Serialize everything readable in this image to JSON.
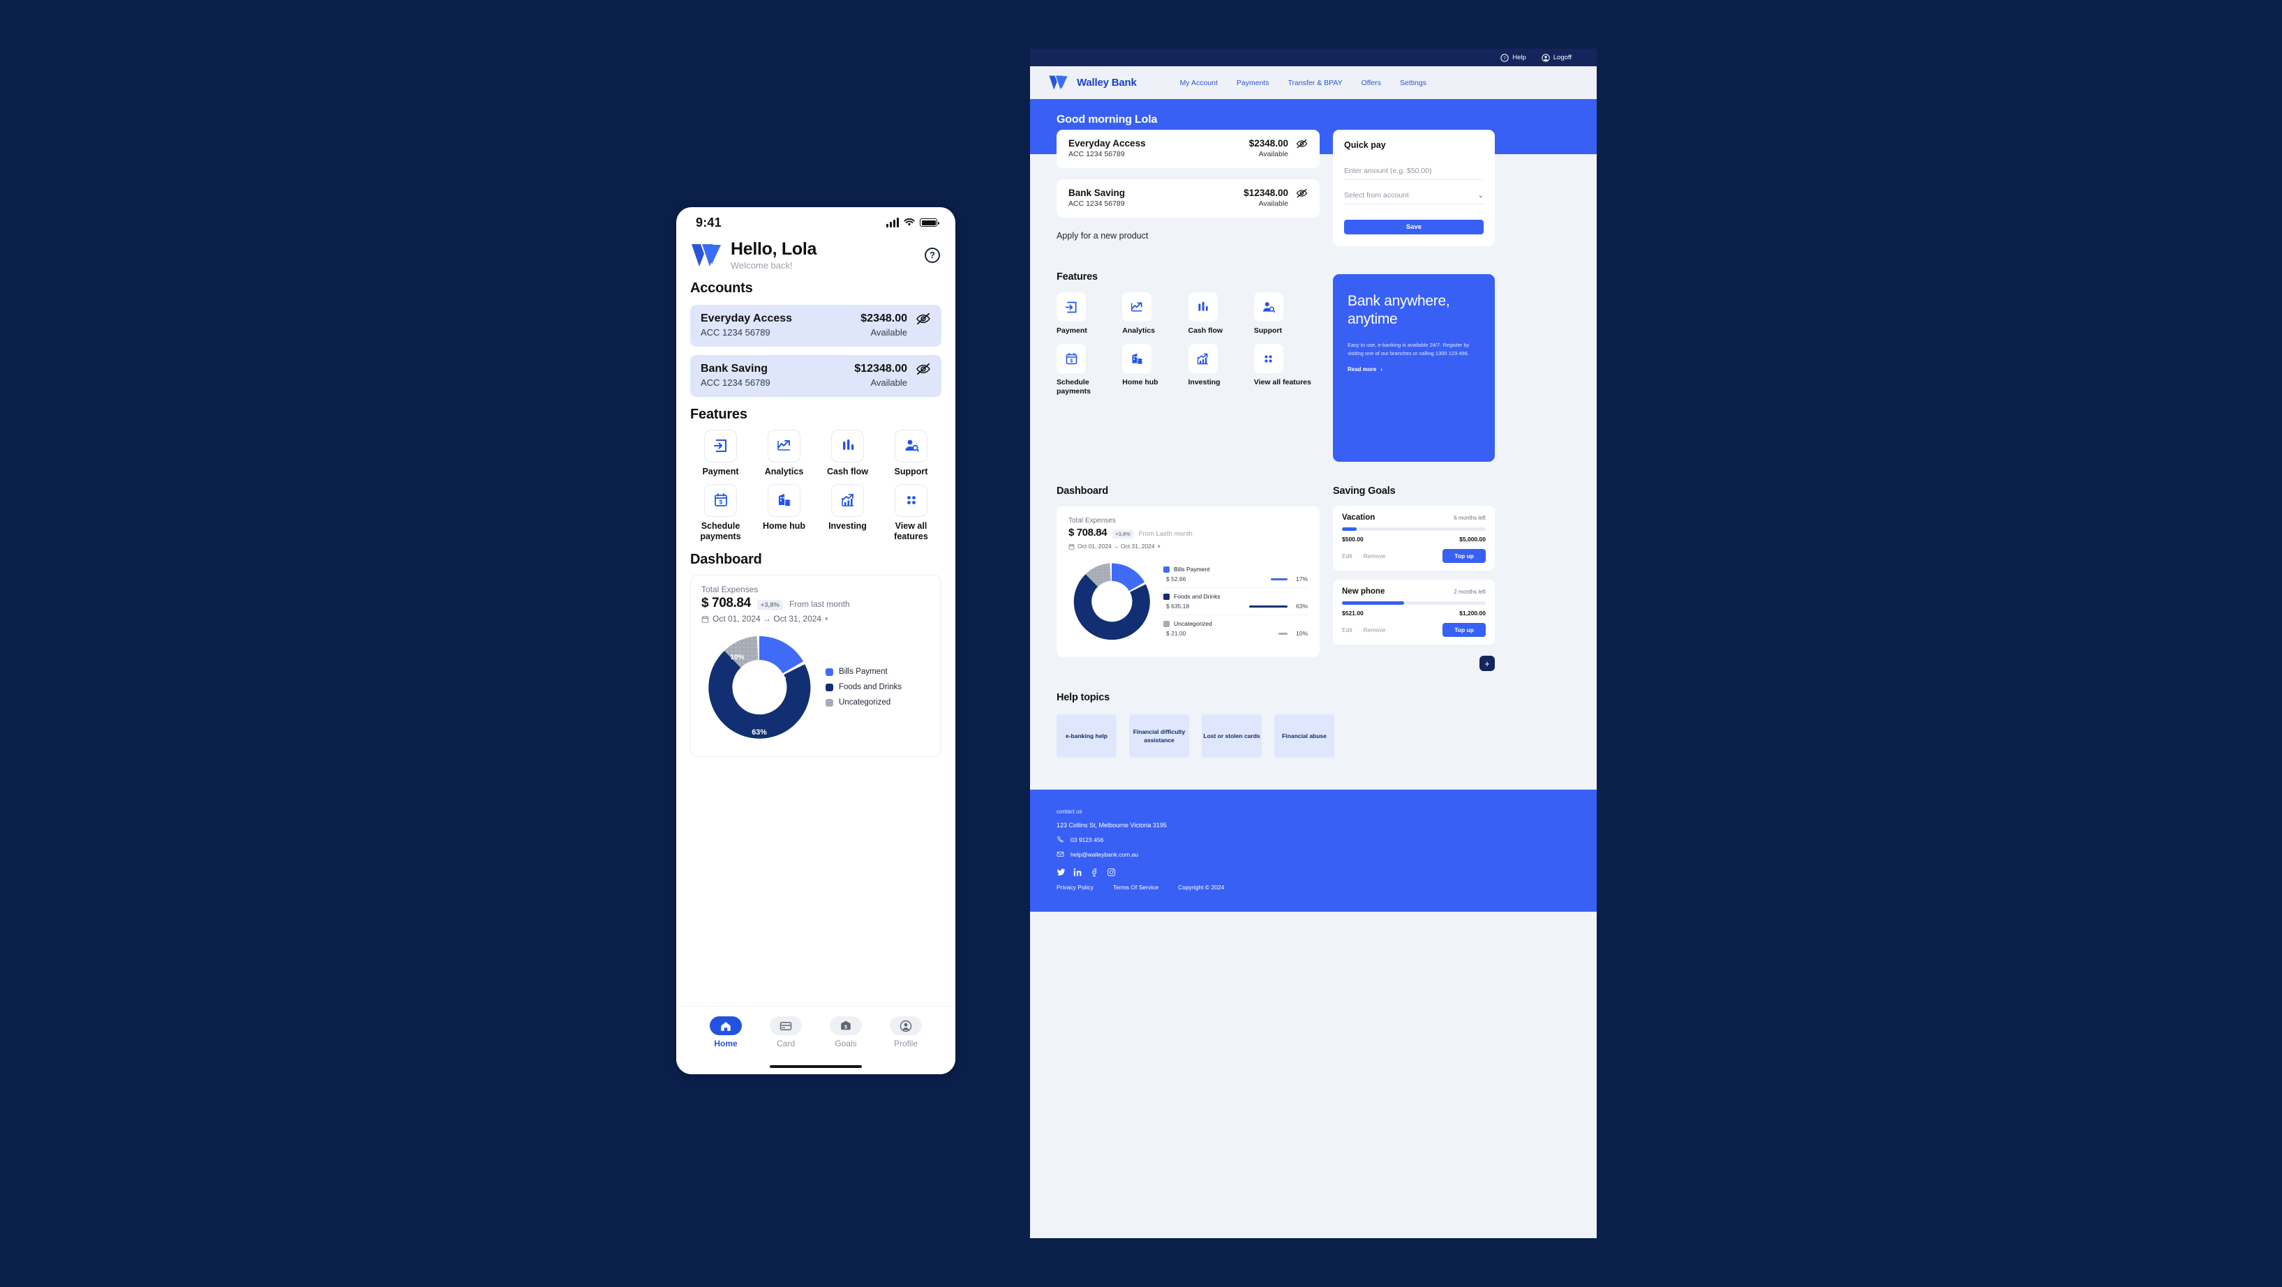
{
  "mobile": {
    "status": {
      "time": "9:41",
      "signal_icon": "cellular-bars-icon",
      "wifi_icon": "wifi-icon",
      "battery_icon": "battery-icon"
    },
    "header": {
      "logo": "walley-bank-logo",
      "greeting": "Hello, Lola",
      "subtitle": "Welcome back!",
      "help_icon": "help-circle-icon"
    },
    "accounts_title": "Accounts",
    "accounts": [
      {
        "name": "Everyday Access",
        "amount": "$2348.00",
        "number": "ACC 1234 56789",
        "status": "Available",
        "eye_icon": "eye-off-icon"
      },
      {
        "name": "Bank Saving",
        "amount": "$12348.00",
        "number": "ACC 1234 56789",
        "status": "Available",
        "eye_icon": "eye-off-icon"
      }
    ],
    "features_title": "Features",
    "features": [
      {
        "label": "Payment",
        "icon": "arrow-into-box-icon"
      },
      {
        "label": "Analytics",
        "icon": "line-chart-arrow-icon"
      },
      {
        "label": "Cash flow",
        "icon": "bar-chart-icon"
      },
      {
        "label": "Support",
        "icon": "person-search-icon"
      },
      {
        "label": "Schedule payments",
        "icon": "calendar-dollar-icon"
      },
      {
        "label": "Home hub",
        "icon": "building-coins-icon"
      },
      {
        "label": "Investing",
        "icon": "growth-chart-icon"
      },
      {
        "label": "View all features",
        "icon": "grid-dots-icon"
      }
    ],
    "dashboard_title": "Dashboard",
    "dashboard": {
      "total_label": "Total Expenses",
      "total_amount": "$ 708.84",
      "change_badge": "+3,8%",
      "change_text": "From last month",
      "date_range": "Oct 01, 2024 → Oct 31, 2024",
      "calendar_icon": "calendar-icon",
      "chevron_icon": "chevron-down-icon"
    },
    "tabs": [
      {
        "label": "Home",
        "icon": "home-icon",
        "active": true
      },
      {
        "label": "Card",
        "icon": "credit-card-icon",
        "active": false
      },
      {
        "label": "Goals",
        "icon": "tag-dollar-icon",
        "active": false
      },
      {
        "label": "Profile",
        "icon": "person-icon",
        "active": false
      }
    ]
  },
  "web": {
    "topbar": [
      {
        "label": "Help",
        "icon": "help-circle-icon"
      },
      {
        "label": "Logoff",
        "icon": "user-circle-icon"
      }
    ],
    "brand": {
      "name": "Walley Bank",
      "logo": "walley-bank-logo"
    },
    "nav": [
      {
        "label": "My Account"
      },
      {
        "label": "Payments"
      },
      {
        "label": "Transfer & BPAY"
      },
      {
        "label": "Offers"
      },
      {
        "label": "Settings"
      }
    ],
    "hero_greeting": "Good morning Lola",
    "accounts": [
      {
        "name": "Everyday Access",
        "amount": "$2348.00",
        "number": "ACC 1234 56789",
        "status": "Available",
        "eye_icon": "eye-off-icon"
      },
      {
        "name": "Bank Saving",
        "amount": "$12348.00",
        "number": "ACC 1234 56789",
        "status": "Available",
        "eye_icon": "eye-off-icon"
      }
    ],
    "apply_link": "Apply for a new product",
    "quick_pay": {
      "title": "Quick pay",
      "amount_placeholder": "Enter amount (e.g. $50.00)",
      "account_placeholder": "Select from account",
      "chevron_icon": "chevron-down-icon",
      "save_label": "Save"
    },
    "features_title": "Features",
    "features": [
      {
        "label": "Payment",
        "icon": "arrow-into-box-icon"
      },
      {
        "label": "Analytics",
        "icon": "line-chart-arrow-icon"
      },
      {
        "label": "Cash flow",
        "icon": "bar-chart-icon"
      },
      {
        "label": "Support",
        "icon": "person-search-icon"
      },
      {
        "label": "Schedule payments",
        "icon": "calendar-dollar-icon"
      },
      {
        "label": "Home hub",
        "icon": "building-coins-icon"
      },
      {
        "label": "Investing",
        "icon": "growth-chart-icon"
      },
      {
        "label": "View all features",
        "icon": "grid-dots-icon"
      }
    ],
    "promo": {
      "title": "Bank anywhere, anytime",
      "body": "Easy to use, e-banking is available 24/7. Register by visiting one of our branches or calling 1300 123 456.",
      "cta": "Read more",
      "cta_icon": "chevron-right-icon"
    },
    "dashboard_title": "Dashboard",
    "dashboard": {
      "total_label": "Total Expenses",
      "total_amount": "$ 708.84",
      "change_badge": "+3,8%",
      "change_text": "From Lasth month",
      "date_range": "Oct 01, 2024 → Oct 31, 2024",
      "calendar_icon": "calendar-icon",
      "chevron_icon": "chevron-down-icon"
    },
    "goals_title": "Saving Goals",
    "goals": [
      {
        "name": "Vacation",
        "time_left": "6 months left",
        "current": "$500.00",
        "target": "$5,000.00",
        "percent": 10,
        "edit": "Edit",
        "remove": "Remove",
        "topup": "Top up"
      },
      {
        "name": "New phone",
        "time_left": "2 months left",
        "current": "$521.00",
        "target": "$1,200.00",
        "percent": 43,
        "edit": "Edit",
        "remove": "Remove",
        "topup": "Top up"
      }
    ],
    "add_goal_icon": "plus-icon",
    "help_title": "Help topics",
    "help_topics": [
      {
        "label": "e-banking help"
      },
      {
        "label": "Financial difficulty assistance"
      },
      {
        "label": "Lost or stolen cards"
      },
      {
        "label": "Financial abuse"
      }
    ],
    "footer": {
      "contact_label": "contact us",
      "address": "123 Collins St, Melbourne Victoria 3195",
      "phone": "03 9123 456",
      "phone_icon": "phone-icon",
      "email": "help@walleybank.com.au",
      "email_icon": "mail-icon",
      "social": [
        "twitter-icon",
        "linkedin-icon",
        "facebook-icon",
        "instagram-icon"
      ],
      "links": [
        "Privacy Policy",
        "Terms Of Service",
        "Copyright © 2024"
      ]
    }
  },
  "chart_data": {
    "type": "pie",
    "title": "Total Expenses",
    "total": 708.84,
    "currency": "$",
    "categories": [
      "Bills Payment",
      "Foods and Drinks",
      "Uncategorized"
    ],
    "values": [
      52.66,
      635.18,
      21.0
    ],
    "percents": [
      17,
      63,
      10
    ],
    "value_labels": [
      "$ 52.66",
      "$ 635.18",
      "$ 21.00"
    ],
    "percent_labels": [
      "17%",
      "63%",
      "10%"
    ],
    "colors": [
      "#3f6bf7",
      "#112f72",
      "#a6acb5"
    ],
    "legend_position": "right",
    "donut_hole": 0.58,
    "date_range": "Oct 01, 2024 → Oct 31, 2024",
    "change": "+3,8%",
    "change_note": "From last month"
  },
  "theme": {
    "brand_blue": "#3860f4",
    "navy": "#14255c",
    "page_bg": "#0b1f4b",
    "light_bg": "#f0f3f8"
  }
}
